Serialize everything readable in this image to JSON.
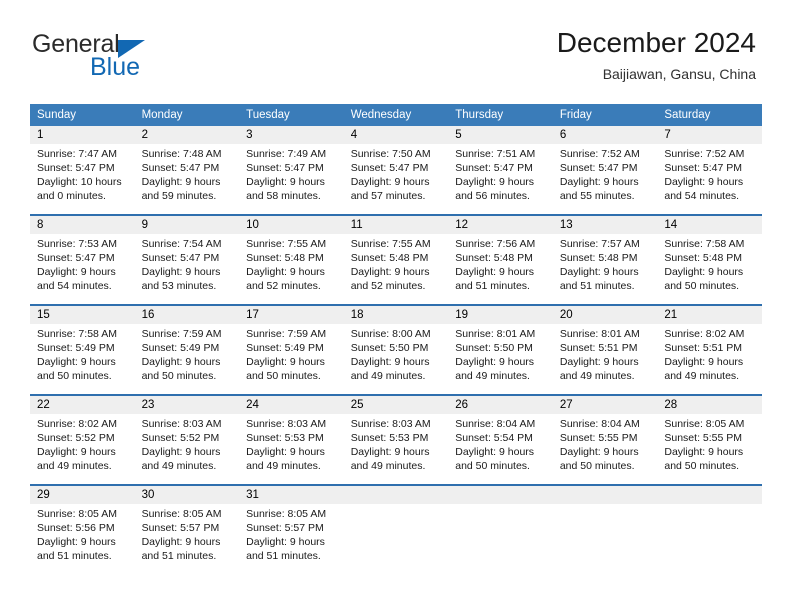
{
  "brand": {
    "name_part1": "General",
    "name_part2": "Blue"
  },
  "header": {
    "title": "December 2024",
    "location": "Baijiawan, Gansu, China"
  },
  "colors": {
    "header_blue": "#3a7cb9",
    "separator_blue": "#2f6fae",
    "daynum_band": "#efefef",
    "brand_blue": "#1268b3"
  },
  "weekday_headers": [
    "Sunday",
    "Monday",
    "Tuesday",
    "Wednesday",
    "Thursday",
    "Friday",
    "Saturday"
  ],
  "weeks": [
    [
      {
        "day": "1",
        "sunrise": "Sunrise: 7:47 AM",
        "sunset": "Sunset: 5:47 PM",
        "daylight_line1": "Daylight: 10 hours",
        "daylight_line2": "and 0 minutes."
      },
      {
        "day": "2",
        "sunrise": "Sunrise: 7:48 AM",
        "sunset": "Sunset: 5:47 PM",
        "daylight_line1": "Daylight: 9 hours",
        "daylight_line2": "and 59 minutes."
      },
      {
        "day": "3",
        "sunrise": "Sunrise: 7:49 AM",
        "sunset": "Sunset: 5:47 PM",
        "daylight_line1": "Daylight: 9 hours",
        "daylight_line2": "and 58 minutes."
      },
      {
        "day": "4",
        "sunrise": "Sunrise: 7:50 AM",
        "sunset": "Sunset: 5:47 PM",
        "daylight_line1": "Daylight: 9 hours",
        "daylight_line2": "and 57 minutes."
      },
      {
        "day": "5",
        "sunrise": "Sunrise: 7:51 AM",
        "sunset": "Sunset: 5:47 PM",
        "daylight_line1": "Daylight: 9 hours",
        "daylight_line2": "and 56 minutes."
      },
      {
        "day": "6",
        "sunrise": "Sunrise: 7:52 AM",
        "sunset": "Sunset: 5:47 PM",
        "daylight_line1": "Daylight: 9 hours",
        "daylight_line2": "and 55 minutes."
      },
      {
        "day": "7",
        "sunrise": "Sunrise: 7:52 AM",
        "sunset": "Sunset: 5:47 PM",
        "daylight_line1": "Daylight: 9 hours",
        "daylight_line2": "and 54 minutes."
      }
    ],
    [
      {
        "day": "8",
        "sunrise": "Sunrise: 7:53 AM",
        "sunset": "Sunset: 5:47 PM",
        "daylight_line1": "Daylight: 9 hours",
        "daylight_line2": "and 54 minutes."
      },
      {
        "day": "9",
        "sunrise": "Sunrise: 7:54 AM",
        "sunset": "Sunset: 5:47 PM",
        "daylight_line1": "Daylight: 9 hours",
        "daylight_line2": "and 53 minutes."
      },
      {
        "day": "10",
        "sunrise": "Sunrise: 7:55 AM",
        "sunset": "Sunset: 5:48 PM",
        "daylight_line1": "Daylight: 9 hours",
        "daylight_line2": "and 52 minutes."
      },
      {
        "day": "11",
        "sunrise": "Sunrise: 7:55 AM",
        "sunset": "Sunset: 5:48 PM",
        "daylight_line1": "Daylight: 9 hours",
        "daylight_line2": "and 52 minutes."
      },
      {
        "day": "12",
        "sunrise": "Sunrise: 7:56 AM",
        "sunset": "Sunset: 5:48 PM",
        "daylight_line1": "Daylight: 9 hours",
        "daylight_line2": "and 51 minutes."
      },
      {
        "day": "13",
        "sunrise": "Sunrise: 7:57 AM",
        "sunset": "Sunset: 5:48 PM",
        "daylight_line1": "Daylight: 9 hours",
        "daylight_line2": "and 51 minutes."
      },
      {
        "day": "14",
        "sunrise": "Sunrise: 7:58 AM",
        "sunset": "Sunset: 5:48 PM",
        "daylight_line1": "Daylight: 9 hours",
        "daylight_line2": "and 50 minutes."
      }
    ],
    [
      {
        "day": "15",
        "sunrise": "Sunrise: 7:58 AM",
        "sunset": "Sunset: 5:49 PM",
        "daylight_line1": "Daylight: 9 hours",
        "daylight_line2": "and 50 minutes."
      },
      {
        "day": "16",
        "sunrise": "Sunrise: 7:59 AM",
        "sunset": "Sunset: 5:49 PM",
        "daylight_line1": "Daylight: 9 hours",
        "daylight_line2": "and 50 minutes."
      },
      {
        "day": "17",
        "sunrise": "Sunrise: 7:59 AM",
        "sunset": "Sunset: 5:49 PM",
        "daylight_line1": "Daylight: 9 hours",
        "daylight_line2": "and 50 minutes."
      },
      {
        "day": "18",
        "sunrise": "Sunrise: 8:00 AM",
        "sunset": "Sunset: 5:50 PM",
        "daylight_line1": "Daylight: 9 hours",
        "daylight_line2": "and 49 minutes."
      },
      {
        "day": "19",
        "sunrise": "Sunrise: 8:01 AM",
        "sunset": "Sunset: 5:50 PM",
        "daylight_line1": "Daylight: 9 hours",
        "daylight_line2": "and 49 minutes."
      },
      {
        "day": "20",
        "sunrise": "Sunrise: 8:01 AM",
        "sunset": "Sunset: 5:51 PM",
        "daylight_line1": "Daylight: 9 hours",
        "daylight_line2": "and 49 minutes."
      },
      {
        "day": "21",
        "sunrise": "Sunrise: 8:02 AM",
        "sunset": "Sunset: 5:51 PM",
        "daylight_line1": "Daylight: 9 hours",
        "daylight_line2": "and 49 minutes."
      }
    ],
    [
      {
        "day": "22",
        "sunrise": "Sunrise: 8:02 AM",
        "sunset": "Sunset: 5:52 PM",
        "daylight_line1": "Daylight: 9 hours",
        "daylight_line2": "and 49 minutes."
      },
      {
        "day": "23",
        "sunrise": "Sunrise: 8:03 AM",
        "sunset": "Sunset: 5:52 PM",
        "daylight_line1": "Daylight: 9 hours",
        "daylight_line2": "and 49 minutes."
      },
      {
        "day": "24",
        "sunrise": "Sunrise: 8:03 AM",
        "sunset": "Sunset: 5:53 PM",
        "daylight_line1": "Daylight: 9 hours",
        "daylight_line2": "and 49 minutes."
      },
      {
        "day": "25",
        "sunrise": "Sunrise: 8:03 AM",
        "sunset": "Sunset: 5:53 PM",
        "daylight_line1": "Daylight: 9 hours",
        "daylight_line2": "and 49 minutes."
      },
      {
        "day": "26",
        "sunrise": "Sunrise: 8:04 AM",
        "sunset": "Sunset: 5:54 PM",
        "daylight_line1": "Daylight: 9 hours",
        "daylight_line2": "and 50 minutes."
      },
      {
        "day": "27",
        "sunrise": "Sunrise: 8:04 AM",
        "sunset": "Sunset: 5:55 PM",
        "daylight_line1": "Daylight: 9 hours",
        "daylight_line2": "and 50 minutes."
      },
      {
        "day": "28",
        "sunrise": "Sunrise: 8:05 AM",
        "sunset": "Sunset: 5:55 PM",
        "daylight_line1": "Daylight: 9 hours",
        "daylight_line2": "and 50 minutes."
      }
    ],
    [
      {
        "day": "29",
        "sunrise": "Sunrise: 8:05 AM",
        "sunset": "Sunset: 5:56 PM",
        "daylight_line1": "Daylight: 9 hours",
        "daylight_line2": "and 51 minutes."
      },
      {
        "day": "30",
        "sunrise": "Sunrise: 8:05 AM",
        "sunset": "Sunset: 5:57 PM",
        "daylight_line1": "Daylight: 9 hours",
        "daylight_line2": "and 51 minutes."
      },
      {
        "day": "31",
        "sunrise": "Sunrise: 8:05 AM",
        "sunset": "Sunset: 5:57 PM",
        "daylight_line1": "Daylight: 9 hours",
        "daylight_line2": "and 51 minutes."
      },
      {
        "day": "",
        "sunrise": "",
        "sunset": "",
        "daylight_line1": "",
        "daylight_line2": ""
      },
      {
        "day": "",
        "sunrise": "",
        "sunset": "",
        "daylight_line1": "",
        "daylight_line2": ""
      },
      {
        "day": "",
        "sunrise": "",
        "sunset": "",
        "daylight_line1": "",
        "daylight_line2": ""
      },
      {
        "day": "",
        "sunrise": "",
        "sunset": "",
        "daylight_line1": "",
        "daylight_line2": ""
      }
    ]
  ]
}
